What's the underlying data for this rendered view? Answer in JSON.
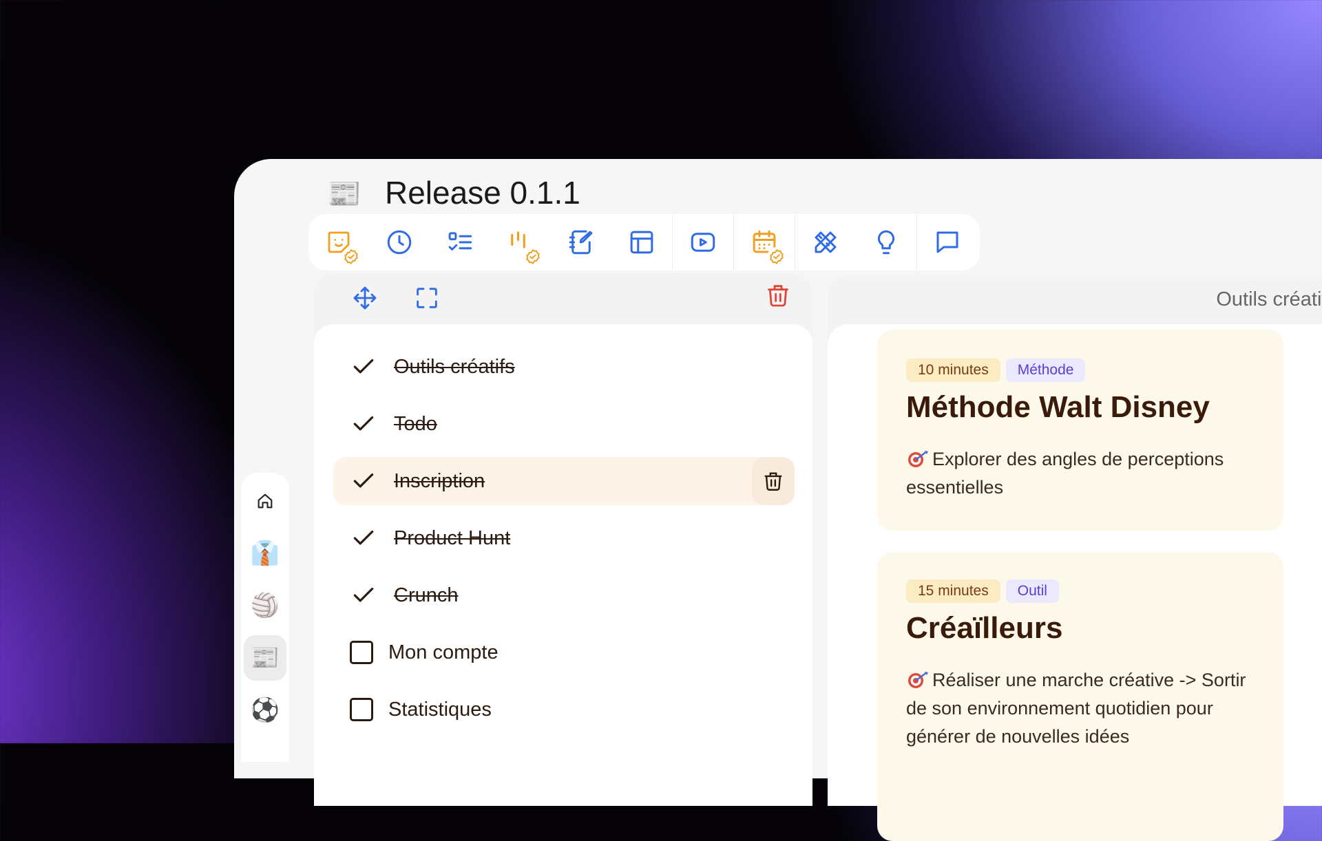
{
  "page": {
    "title": "Release 0.1.1",
    "title_emoji": "📰"
  },
  "toolbar": {
    "buttons": [
      {
        "icon": "sticky-note-smile-icon",
        "badge": "check-badge-icon"
      },
      {
        "icon": "clock-icon"
      },
      {
        "icon": "checklist-icon"
      },
      {
        "icon": "pomodoro-bars-icon",
        "badge": "check-badge-icon"
      },
      {
        "icon": "notebook-edit-icon"
      },
      {
        "icon": "layout-icon"
      },
      {
        "icon": "video-play-icon"
      },
      {
        "icon": "calendar-icon",
        "badge": "check-badge-icon"
      },
      {
        "icon": "pencil-ruler-icon"
      },
      {
        "icon": "lightbulb-icon"
      },
      {
        "icon": "chat-bubble-icon"
      }
    ]
  },
  "todo": {
    "items": [
      {
        "label": "Outils créatifs",
        "done": true
      },
      {
        "label": "Todo",
        "done": true
      },
      {
        "label": "Inscription",
        "done": true,
        "highlighted": true
      },
      {
        "label": "Product Hunt",
        "done": true
      },
      {
        "label": "Crunch",
        "done": true
      },
      {
        "label": "Mon compte",
        "done": false
      },
      {
        "label": "Statistiques",
        "done": false
      }
    ]
  },
  "right_panel": {
    "title": "Outils créatifs",
    "cards": [
      {
        "duration": "10 minutes",
        "category": "Méthode",
        "title": "Méthode Walt Disney",
        "description": "Explorer des angles de perceptions essentielles"
      },
      {
        "duration": "15 minutes",
        "category": "Outil",
        "title": "Créaïlleurs",
        "description": "Réaliser une marche créative -> Sortir de son environnement quotidien pour générer de nouvelles idées"
      }
    ]
  },
  "sidebar": {
    "items": [
      {
        "icon": "home-icon"
      },
      {
        "emoji": "👔"
      },
      {
        "emoji": "🏐"
      },
      {
        "emoji": "📰",
        "active": true
      },
      {
        "emoji": "⚽"
      }
    ]
  },
  "colors": {
    "accent_blue": "#2f6be5",
    "accent_orange": "#f0a020",
    "danger_red": "#e0453a",
    "text_brown": "#3a1a0a"
  }
}
